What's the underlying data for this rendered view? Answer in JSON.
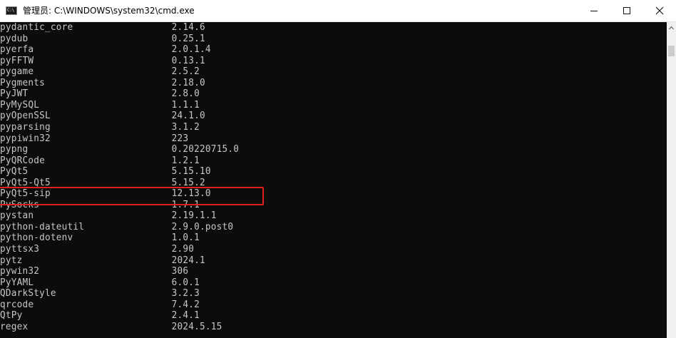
{
  "window": {
    "title": "管理员: C:\\WINDOWS\\system32\\cmd.exe",
    "app_icon_text": "C:\\"
  },
  "icons": {
    "app": "cmd-icon",
    "minimize": "minimize-icon",
    "maximize": "maximize-icon",
    "close": "close-icon",
    "scroll_up": "chevron-up-icon"
  },
  "terminal": {
    "rows": [
      {
        "name": "pydantic_core",
        "version": "2.14.6"
      },
      {
        "name": "pydub",
        "version": "0.25.1"
      },
      {
        "name": "pyerfa",
        "version": "2.0.1.4"
      },
      {
        "name": "pyFFTW",
        "version": "0.13.1"
      },
      {
        "name": "pygame",
        "version": "2.5.2"
      },
      {
        "name": "Pygments",
        "version": "2.18.0"
      },
      {
        "name": "PyJWT",
        "version": "2.8.0"
      },
      {
        "name": "PyMySQL",
        "version": "1.1.1"
      },
      {
        "name": "pyOpenSSL",
        "version": "24.1.0"
      },
      {
        "name": "pyparsing",
        "version": "3.1.2"
      },
      {
        "name": "pypiwin32",
        "version": "223"
      },
      {
        "name": "pypng",
        "version": "0.20220715.0"
      },
      {
        "name": "PyQRCode",
        "version": "1.2.1"
      },
      {
        "name": "PyQt5",
        "version": "5.15.10"
      },
      {
        "name": "PyQt5-Qt5",
        "version": "5.15.2"
      },
      {
        "name": "PyQt5-sip",
        "version": "12.13.0"
      },
      {
        "name": "PySocks",
        "version": "1.7.1"
      },
      {
        "name": "pystan",
        "version": "2.19.1.1"
      },
      {
        "name": "python-dateutil",
        "version": "2.9.0.post0"
      },
      {
        "name": "python-dotenv",
        "version": "1.0.1"
      },
      {
        "name": "pyttsx3",
        "version": "2.90"
      },
      {
        "name": "pytz",
        "version": "2024.1"
      },
      {
        "name": "pywin32",
        "version": "306"
      },
      {
        "name": "PyYAML",
        "version": "6.0.1"
      },
      {
        "name": "QDarkStyle",
        "version": "3.2.3"
      },
      {
        "name": "qrcode",
        "version": "7.4.2"
      },
      {
        "name": "QtPy",
        "version": "2.4.1"
      },
      {
        "name": "regex",
        "version": "2024.5.15"
      }
    ]
  },
  "highlight": {
    "row_index": 17,
    "color": "#e0201c"
  },
  "colors": {
    "terminal_background": "#0c0c0c",
    "terminal_text": "#c7c7c7",
    "titlebar_background": "#ffffff",
    "scrollbar_track": "#f0f0f0",
    "scrollbar_thumb": "#cdcdcd"
  }
}
